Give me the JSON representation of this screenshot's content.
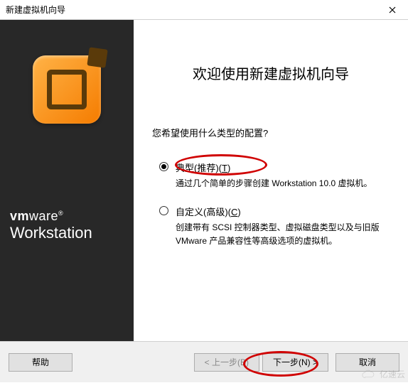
{
  "window": {
    "title": "新建虚拟机向导"
  },
  "sidebar": {
    "brand_top": "vmware",
    "brand_bottom": "Workstation"
  },
  "main": {
    "heading": "欢迎使用新建虚拟机向导",
    "prompt": "您希望使用什么类型的配置?",
    "option1": {
      "label_pre": "典型(推荐)(",
      "label_key": "T",
      "label_post": ")",
      "desc": "通过几个简单的步骤创建 Workstation 10.0 虚拟机。"
    },
    "option2": {
      "label_pre": "自定义(高级)(",
      "label_key": "C",
      "label_post": ")",
      "desc": "创建带有 SCSI 控制器类型、虚拟磁盘类型以及与旧版 VMware 产品兼容性等高级选项的虚拟机。"
    }
  },
  "footer": {
    "help": "帮助",
    "back": "< 上一步(B)",
    "next": "下一步(N) >",
    "cancel": "取消"
  },
  "watermark": "亿速云"
}
